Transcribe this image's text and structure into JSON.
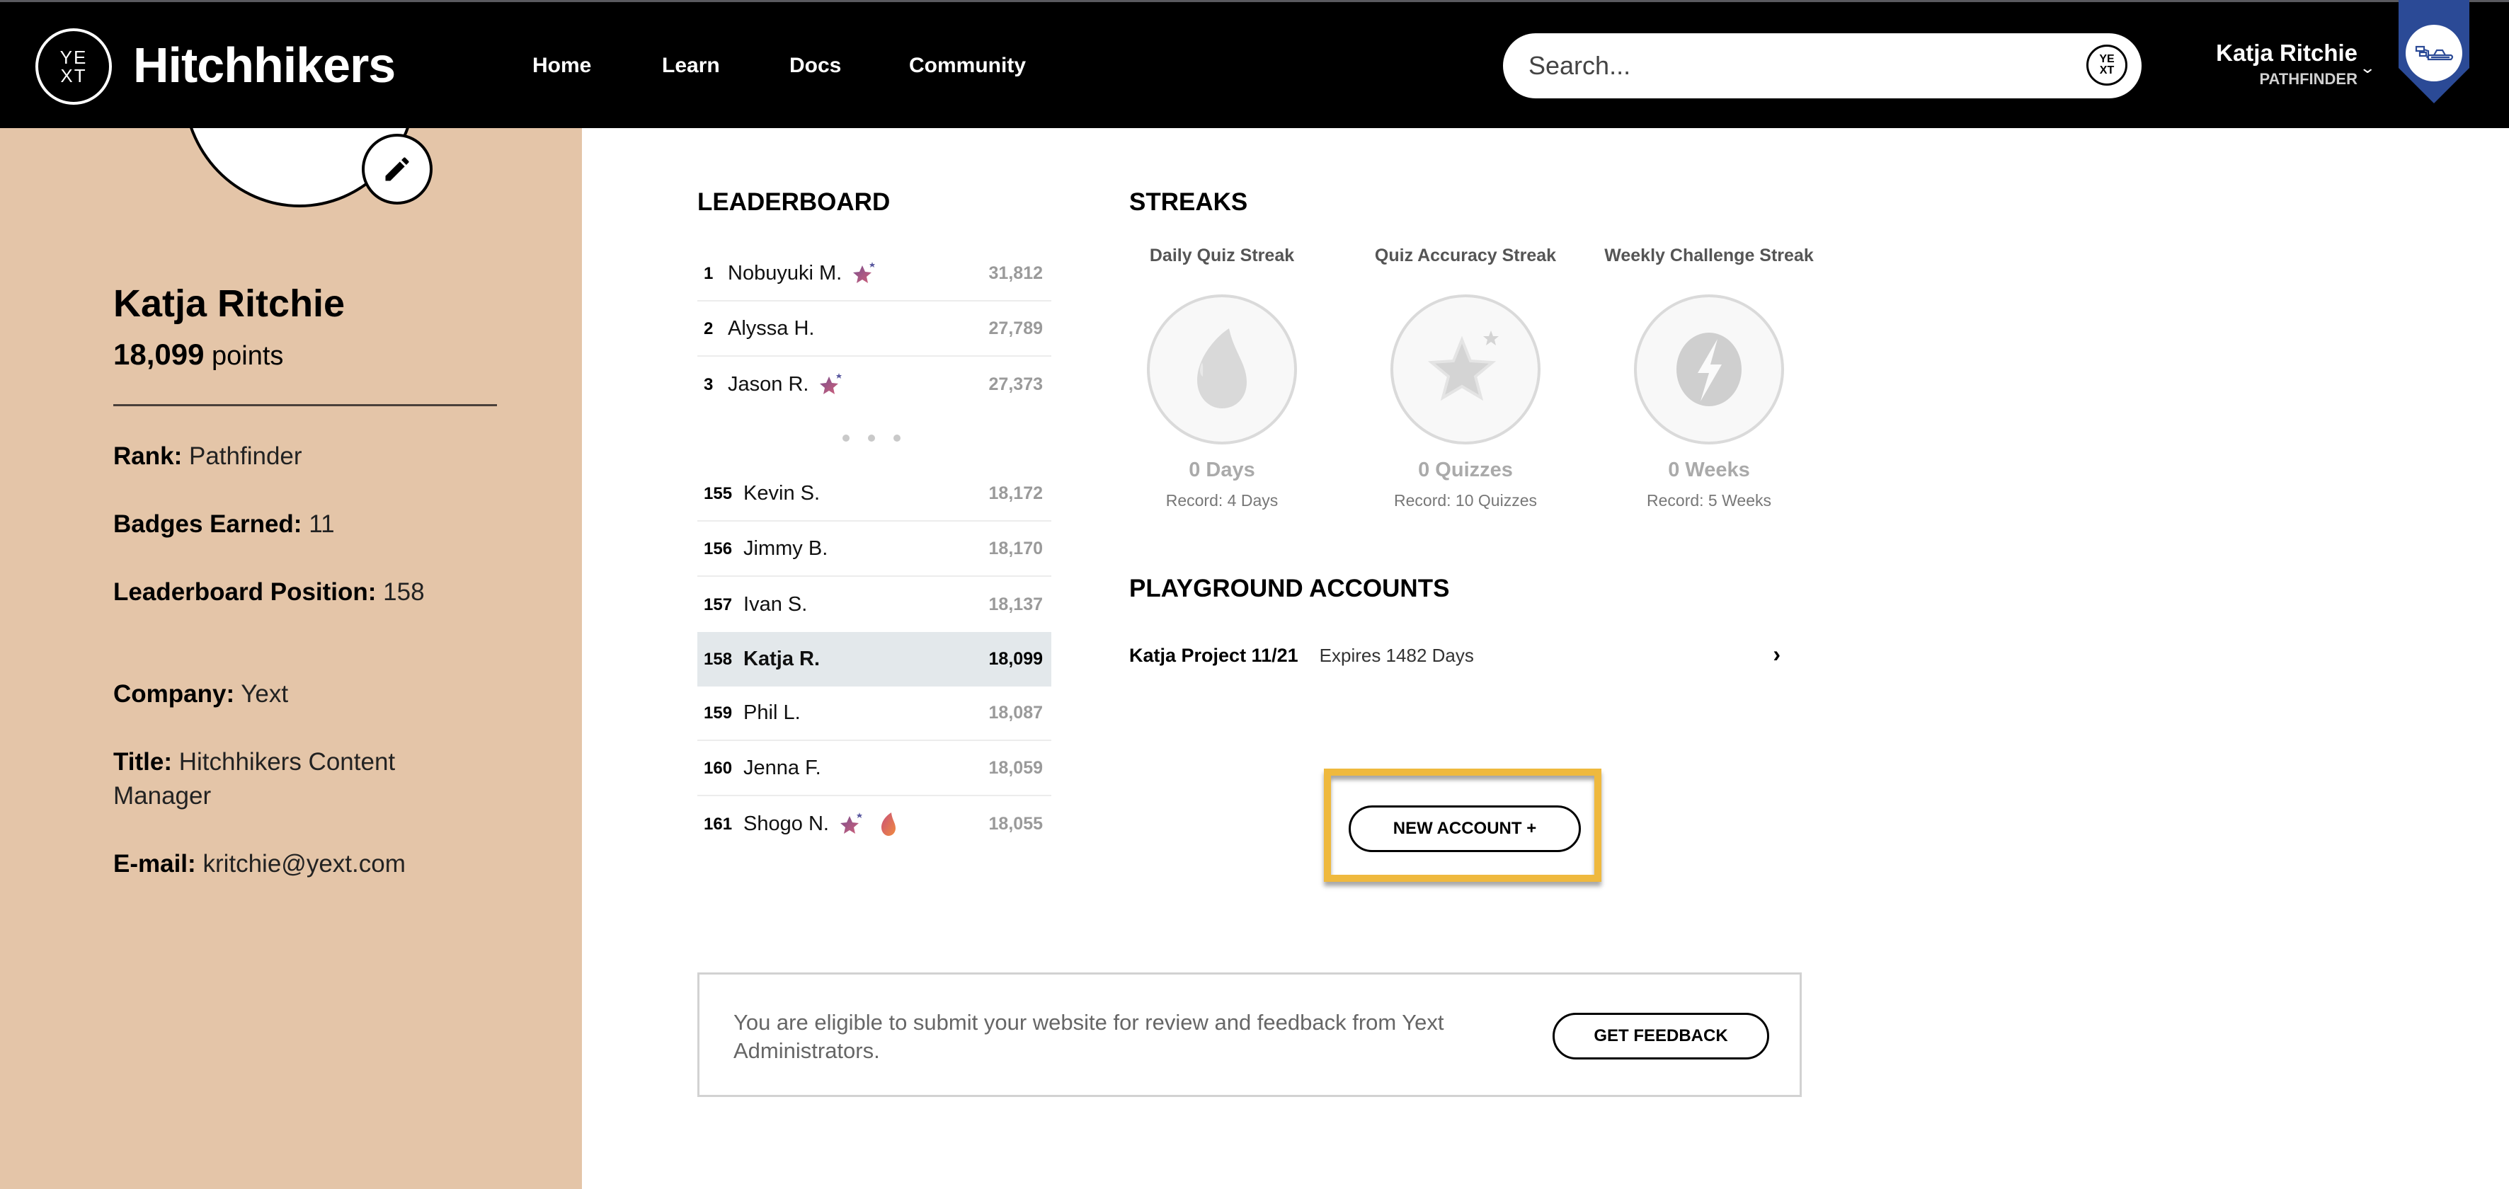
{
  "header": {
    "logo_top": "YE",
    "logo_bottom": "XT",
    "brand": "Hitchhikers",
    "nav": [
      "Home",
      "Learn",
      "Docs",
      "Community"
    ],
    "search_placeholder": "Search...",
    "search_logo_top": "YE",
    "search_logo_bottom": "XT",
    "user_name": "Katja Ritchie",
    "user_rank": "PATHFINDER",
    "badge_color": "#2b4a96"
  },
  "profile": {
    "name": "Katja Ritchie",
    "points_value": "18,099",
    "points_label": "points",
    "fields": [
      {
        "label": "Rank:",
        "value": "Pathfinder"
      },
      {
        "label": "Badges Earned:",
        "value": "11"
      },
      {
        "label": "Leaderboard Position:",
        "value": "158"
      },
      {
        "label": "Company:",
        "value": "Yext"
      },
      {
        "label": "Title:",
        "value": "Hitchhikers Content Manager"
      },
      {
        "label": "E-mail:",
        "value": "kritchie@yext.com"
      }
    ],
    "background": "#e4c5a8"
  },
  "leaderboard": {
    "title": "LEADERBOARD",
    "top": [
      {
        "rank": "1",
        "name": "Nobuyuki M.",
        "score": "31,812",
        "icons": [
          "star"
        ]
      },
      {
        "rank": "2",
        "name": "Alyssa H.",
        "score": "27,789",
        "icons": []
      },
      {
        "rank": "3",
        "name": "Jason R.",
        "score": "27,373",
        "icons": [
          "star"
        ]
      }
    ],
    "nearby": [
      {
        "rank": "155",
        "name": "Kevin S.",
        "score": "18,172",
        "icons": []
      },
      {
        "rank": "156",
        "name": "Jimmy B.",
        "score": "18,170",
        "icons": []
      },
      {
        "rank": "157",
        "name": "Ivan S.",
        "score": "18,137",
        "icons": []
      },
      {
        "rank": "158",
        "name": "Katja R.",
        "score": "18,099",
        "icons": [],
        "current_user": true
      },
      {
        "rank": "159",
        "name": "Phil L.",
        "score": "18,087",
        "icons": []
      },
      {
        "rank": "160",
        "name": "Jenna F.",
        "score": "18,059",
        "icons": []
      },
      {
        "rank": "161",
        "name": "Shogo N.",
        "score": "18,055",
        "icons": [
          "star",
          "flame"
        ]
      }
    ]
  },
  "streaks": {
    "title": "STREAKS",
    "items": [
      {
        "label": "Daily Quiz Streak",
        "icon": "flame-icon",
        "value": "0 Days",
        "record": "Record: 4 Days"
      },
      {
        "label": "Quiz Accuracy Streak",
        "icon": "star-icon",
        "value": "0 Quizzes",
        "record": "Record: 10 Quizzes"
      },
      {
        "label": "Weekly Challenge Streak",
        "icon": "lightning-icon",
        "value": "0 Weeks",
        "record": "Record: 5 Weeks"
      }
    ]
  },
  "playground": {
    "title": "PLAYGROUND ACCOUNTS",
    "accounts": [
      {
        "name": "Katja Project 11/21",
        "expires": "Expires 1482 Days"
      }
    ],
    "new_account_label": "NEW ACCOUNT +",
    "highlight_color": "#efb93e"
  },
  "feedback": {
    "text": "You are eligible to submit your website for review and feedback from Yext Administrators.",
    "button_label": "GET FEEDBACK"
  }
}
